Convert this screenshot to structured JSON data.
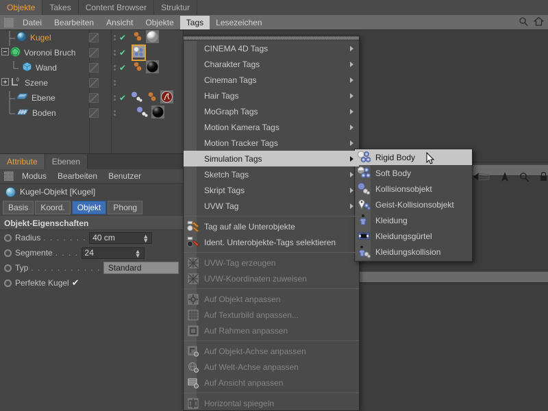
{
  "window": {
    "tabs": [
      {
        "label": "Objekte",
        "active": true
      },
      {
        "label": "Takes",
        "active": false
      },
      {
        "label": "Content Browser",
        "active": false
      },
      {
        "label": "Struktur",
        "active": false
      }
    ],
    "menubar": {
      "items": [
        {
          "label": "Datei",
          "active": false
        },
        {
          "label": "Bearbeiten",
          "active": false
        },
        {
          "label": "Ansicht",
          "active": false
        },
        {
          "label": "Objekte",
          "active": false
        },
        {
          "label": "Tags",
          "active": true
        },
        {
          "label": "Lesezeichen",
          "active": false
        }
      ],
      "right_icons": [
        "search-icon",
        "home-icon"
      ]
    }
  },
  "object_manager": {
    "rows": [
      {
        "name": "Kugel",
        "selected": true,
        "indent": 1,
        "expander": "none",
        "icon": "sphere",
        "check": true,
        "tags": [
          "orange-dots",
          "white-sphere"
        ]
      },
      {
        "name": "Voronoi Bruch",
        "selected": false,
        "indent": 0,
        "expander": "minus",
        "icon": "voronoi",
        "check": true,
        "tags": [
          "voronoi-tag-selected"
        ]
      },
      {
        "name": "Wand",
        "selected": false,
        "indent": 2,
        "expander": "none",
        "icon": "cube",
        "check": true,
        "tags": [
          "orange-dots",
          "black-sphere"
        ]
      },
      {
        "name": "Szene",
        "selected": false,
        "indent": 0,
        "expander": "plus",
        "icon": "layer-zero",
        "check": false,
        "tags": []
      },
      {
        "name": "Ebene",
        "selected": false,
        "indent": 1,
        "expander": "none",
        "icon": "plane",
        "check": true,
        "tags": [
          "blue-dots",
          "orange-dots",
          "red-dynamics"
        ]
      },
      {
        "name": "Boden",
        "selected": false,
        "indent": 1,
        "expander": "none",
        "icon": "floor",
        "check": false,
        "tags": [
          "blue-dots",
          "black-sphere"
        ]
      }
    ]
  },
  "attribute_manager": {
    "tabs": [
      {
        "label": "Attribute",
        "active": true
      },
      {
        "label": "Ebenen",
        "active": false
      }
    ],
    "menu": [
      "Modus",
      "Bearbeiten",
      "Benutzer"
    ],
    "object_title": "Kugel-Objekt [Kugel]",
    "subtabs": [
      {
        "label": "Basis",
        "active": false
      },
      {
        "label": "Koord.",
        "active": false
      },
      {
        "label": "Objekt",
        "active": true
      },
      {
        "label": "Phong",
        "active": false
      }
    ],
    "section_title": "Objekt-Eigenschaften",
    "properties": [
      {
        "label": "Radius",
        "dots": ". . . . . . .",
        "value": "40 cm",
        "type": "number"
      },
      {
        "label": "Segmente",
        "dots": ". . . .",
        "value": "24",
        "type": "number"
      },
      {
        "label": "Typ",
        "dots": ". . . . . . . . . . .",
        "value": "Standard",
        "type": "combo"
      },
      {
        "label": "Perfekte Kugel",
        "dots": "",
        "value": "✔",
        "type": "checkbox"
      }
    ]
  },
  "tags_menu": {
    "groups": [
      {
        "label": "CINEMA 4D Tags",
        "submenu": true,
        "dim": false,
        "icon": null
      },
      {
        "label": "Charakter Tags",
        "submenu": true,
        "dim": false,
        "icon": null
      },
      {
        "label": "Cineman Tags",
        "submenu": true,
        "dim": false,
        "icon": null
      },
      {
        "label": "Hair Tags",
        "submenu": true,
        "dim": false,
        "icon": null
      },
      {
        "label": "MoGraph Tags",
        "submenu": true,
        "dim": false,
        "icon": null
      },
      {
        "label": "Motion Kamera Tags",
        "submenu": true,
        "dim": false,
        "icon": null
      },
      {
        "label": "Motion Tracker Tags",
        "submenu": true,
        "dim": false,
        "icon": null
      },
      {
        "label": "Simulation Tags",
        "submenu": true,
        "dim": false,
        "icon": null,
        "highlighted": true
      },
      {
        "label": "Sketch Tags",
        "submenu": true,
        "dim": false,
        "icon": null
      },
      {
        "label": "Skript Tags",
        "submenu": true,
        "dim": false,
        "icon": null
      },
      {
        "label": "UVW Tag",
        "submenu": true,
        "dim": false,
        "icon": null
      }
    ],
    "actions1": [
      {
        "label": "Tag auf alle Unterobjekte",
        "icon": "tag-children-icon",
        "dim": false
      },
      {
        "label": "Ident. Unterobjekte-Tags selektieren",
        "icon": "tag-select-icon",
        "dim": false
      }
    ],
    "actions2": [
      {
        "label": "UVW-Tag erzeugen",
        "icon": "uvw-icon",
        "dim": true
      },
      {
        "label": "UVW-Koordinaten zuweisen",
        "icon": "uvw-icon",
        "dim": true
      }
    ],
    "actions3": [
      {
        "label": "Auf Objekt anpassen",
        "icon": "fit-object-icon",
        "dim": true
      },
      {
        "label": "Auf Texturbild anpassen...",
        "icon": "fit-texture-icon",
        "dim": true
      },
      {
        "label": "Auf Rahmen anpassen",
        "icon": "fit-frame-icon",
        "dim": true
      }
    ],
    "actions4": [
      {
        "label": "Auf Objekt-Achse anpassen",
        "icon": "fit-object-axis-icon",
        "dim": true
      },
      {
        "label": "Auf Welt-Achse anpassen",
        "icon": "fit-world-axis-icon",
        "dim": true
      },
      {
        "label": "Auf Ansicht anpassen",
        "icon": "fit-view-icon",
        "dim": true
      }
    ],
    "actions5": [
      {
        "label": "Horizontal spiegeln",
        "icon": "mirror-h-icon",
        "dim": true
      }
    ]
  },
  "simulation_submenu": {
    "items": [
      {
        "label": "Rigid Body",
        "icon": "rigid-body-icon",
        "highlighted": true
      },
      {
        "label": "Soft Body",
        "icon": "soft-body-icon",
        "highlighted": false
      },
      {
        "label": "Kollisionsobjekt",
        "icon": "collider-icon",
        "highlighted": false
      },
      {
        "label": "Geist-Kollisionsobjekt",
        "icon": "ghost-collider-icon",
        "highlighted": false
      },
      {
        "label": "Kleidung",
        "icon": "cloth-icon",
        "highlighted": false
      },
      {
        "label": "Kleidungsgürtel",
        "icon": "cloth-belt-icon",
        "highlighted": false
      },
      {
        "label": "Kleidungskollision",
        "icon": "cloth-collider-icon",
        "highlighted": false
      }
    ]
  },
  "viewport_toolbar": {
    "icons": [
      "move-view-icon",
      "camera-icon",
      "magnify-icon",
      "lock-icon"
    ]
  },
  "colors": {
    "accent_orange": "#f0a030",
    "panel_bg": "#454545",
    "menu_bg": "#4a4a4a",
    "highlight": "#c6c6c6",
    "tab_active_blue": "#3c6fb4",
    "check_green": "#5fd39a"
  }
}
